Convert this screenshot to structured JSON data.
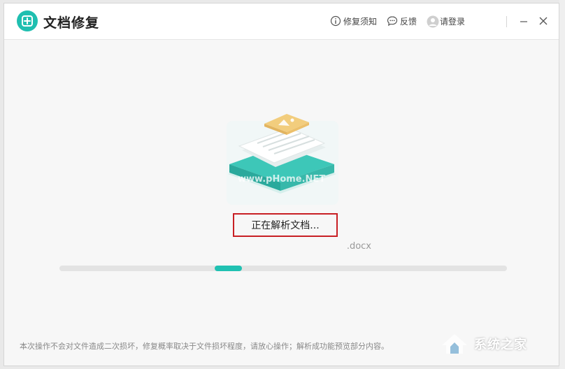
{
  "app": {
    "title": "文档修复",
    "logo_icon": "document-repair-icon"
  },
  "header": {
    "actions": [
      {
        "label": "修复须知",
        "icon": "info-icon"
      },
      {
        "label": "反馈",
        "icon": "chat-bubble-icon"
      },
      {
        "label": "请登录",
        "icon": "user-avatar-icon"
      }
    ]
  },
  "window_controls": {
    "minimize_icon": "minimize-icon",
    "close_icon": "close-icon"
  },
  "main": {
    "status_text": "正在解析文档...",
    "file_name": ".docx",
    "progress": {
      "fraction_start": 0.347,
      "fraction_end": 0.408
    }
  },
  "hero_watermark": "www.pHome.NET",
  "footer": {
    "note": "本次操作不会对文件造成二次损坏，修复概率取决于文件损坏程度，请放心操作；解析成功能预览部分内容。"
  },
  "watermark": {
    "text": "系统之家"
  },
  "colors": {
    "accent": "#20c1b2",
    "highlight_border": "#c81f24",
    "doc_tag": "#f2cd7d"
  }
}
